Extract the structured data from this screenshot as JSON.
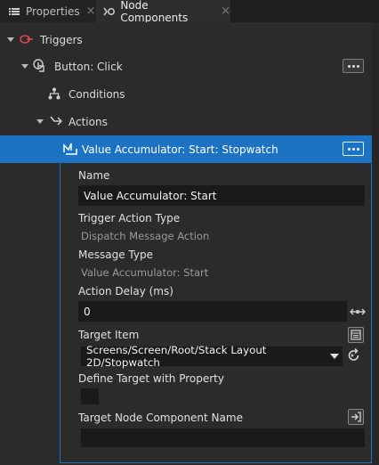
{
  "tabs": [
    {
      "label": "Properties",
      "close": "×",
      "icon": "list-icon"
    },
    {
      "label": "Node Components",
      "close": "×",
      "icon": "node-components-icon"
    }
  ],
  "tree": {
    "triggers": {
      "label": "Triggers",
      "icon": "trigger-icon"
    },
    "button_click": {
      "label": "Button: Click",
      "icon": "hand-pointer-icon"
    },
    "conditions": {
      "label": "Conditions",
      "icon": "conditions-icon"
    },
    "actions": {
      "label": "Actions",
      "icon": "actions-arrow-icon"
    },
    "selected_action": {
      "label": "Value Accumulator: Start: Stopwatch",
      "icon": "action-icon"
    }
  },
  "properties": {
    "name": {
      "label": "Name",
      "value": "Value Accumulator: Start"
    },
    "trigger_action_type": {
      "label": "Trigger Action Type",
      "value": "Dispatch Message Action"
    },
    "message_type": {
      "label": "Message Type",
      "value": "Value Accumulator: Start"
    },
    "action_delay": {
      "label": "Action Delay (ms)",
      "value": "0"
    },
    "target_item": {
      "label": "Target Item",
      "value": "Screens/Screen/Root/Stack Layout 2D/Stopwatch"
    },
    "define_target": {
      "label": "Define Target with Property",
      "checked": false
    },
    "target_node_component_name": {
      "label": "Target Node Component Name",
      "value": ""
    }
  },
  "colors": {
    "accent": "#1c73c4",
    "background": "#2b2b2b",
    "field": "#1a1a1a",
    "trigger_icon": "#e0494f"
  }
}
